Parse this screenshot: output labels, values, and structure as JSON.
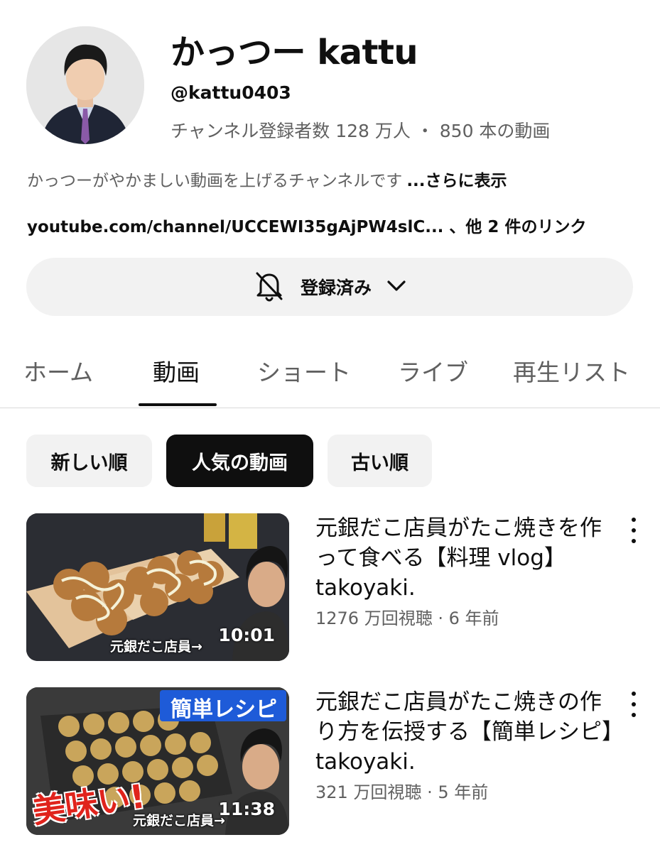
{
  "channel": {
    "name": "かっつー kattu",
    "handle": "@kattu0403",
    "stats": "チャンネル登録者数 128 万人 ・ 850 本の動画",
    "description": "かっつーがやかましい動画を上げるチャンネルです",
    "description_more": "...さらに表示",
    "links": "youtube.com/channel/UCCEWI35gAjPW4slC... 、他 2 件のリンク"
  },
  "subscribe": {
    "label": "登録済み",
    "icon": "bell-off-icon"
  },
  "tabs": [
    {
      "label": "ホーム",
      "active": false
    },
    {
      "label": "動画",
      "active": true
    },
    {
      "label": "ショート",
      "active": false
    },
    {
      "label": "ライブ",
      "active": false
    },
    {
      "label": "再生リスト",
      "active": false
    }
  ],
  "sort_chips": [
    {
      "label": "新しい順",
      "selected": false
    },
    {
      "label": "人気の動画",
      "selected": true
    },
    {
      "label": "古い順",
      "selected": false
    }
  ],
  "videos": [
    {
      "title": "元銀だこ店員がたこ焼きを作って食べる【料理 vlog】takoyaki.",
      "meta": "1276 万回視聴 · 6 年前",
      "duration": "10:01",
      "thumb_caption": "元銀だこ店員→"
    },
    {
      "title": "元銀だこ店員がたこ焼きの作り方を伝授する【簡単レシピ】takoyaki.",
      "meta": "321 万回視聴 · 5 年前",
      "duration": "11:38",
      "thumb_caption": "元銀だこ店員→",
      "thumb_banner": "簡単レシピ",
      "thumb_big_text": "美味い!"
    }
  ],
  "colors": {
    "text_primary": "#0f0f0f",
    "text_secondary": "#606060",
    "chip_bg": "#f2f2f2",
    "chip_selected_bg": "#0f0f0f",
    "banner_blue": "#1e5bd8",
    "big_text_red": "#e0231c"
  }
}
